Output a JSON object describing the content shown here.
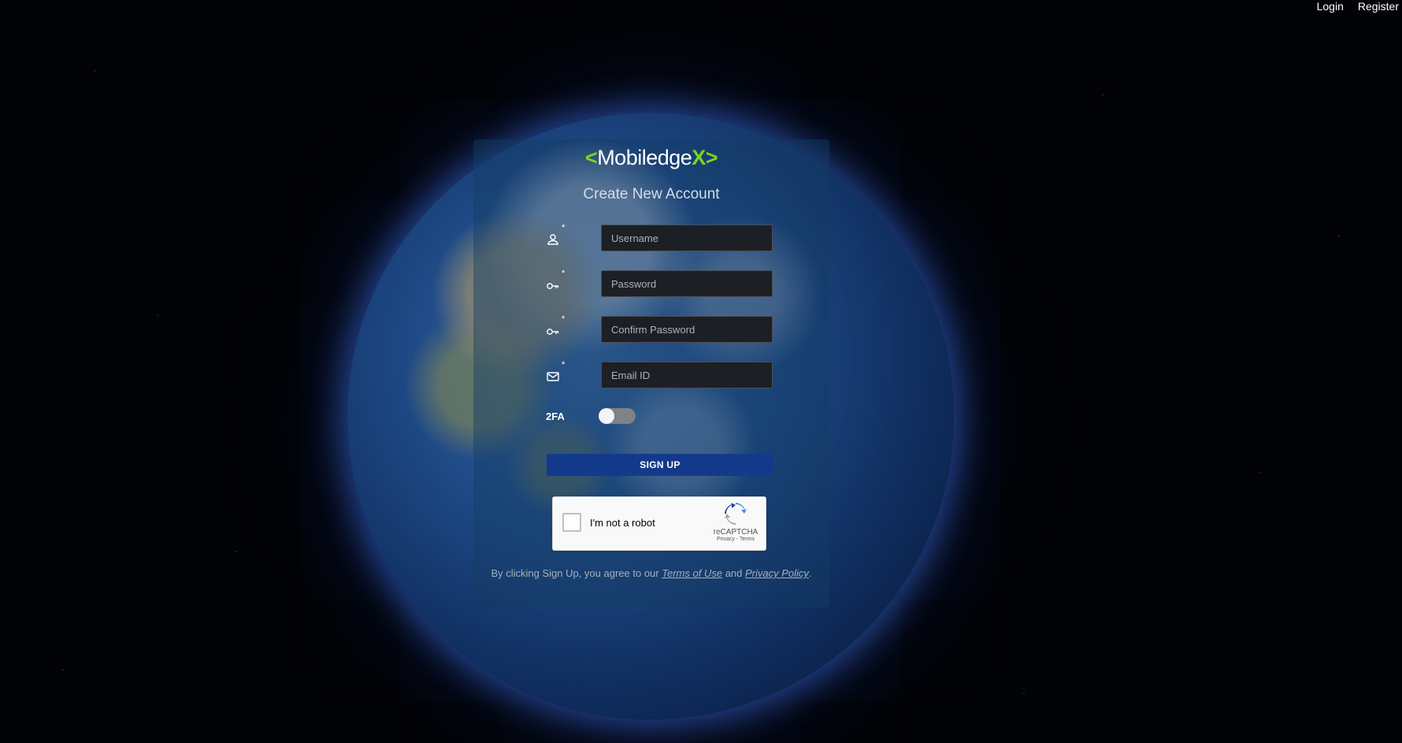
{
  "nav": {
    "login": "Login",
    "register": "Register"
  },
  "logo": {
    "open": "<",
    "text": "Mobiledge",
    "x": "X",
    "close": ">"
  },
  "title": "Create New Account",
  "required_mark": "*",
  "fields": {
    "username": {
      "placeholder": "Username",
      "icon": "user-icon"
    },
    "password": {
      "placeholder": "Password",
      "icon": "key-icon"
    },
    "confirm_password": {
      "placeholder": "Confirm Password",
      "icon": "key-icon"
    },
    "email": {
      "placeholder": "Email ID",
      "icon": "mail-icon"
    }
  },
  "twofa": {
    "label": "2FA",
    "enabled": false
  },
  "signup_label": "SIGN UP",
  "captcha": {
    "label": "I'm not a robot",
    "brand": "reCAPTCHA",
    "links": "Privacy - Terms"
  },
  "footer": {
    "prefix": "By clicking Sign Up, you agree to our",
    "terms": "Terms of Use",
    "and": "and",
    "privacy": "Privacy Policy",
    "suffix": "."
  },
  "colors": {
    "accent_green": "#7ed321",
    "button_blue": "#133a8a"
  }
}
